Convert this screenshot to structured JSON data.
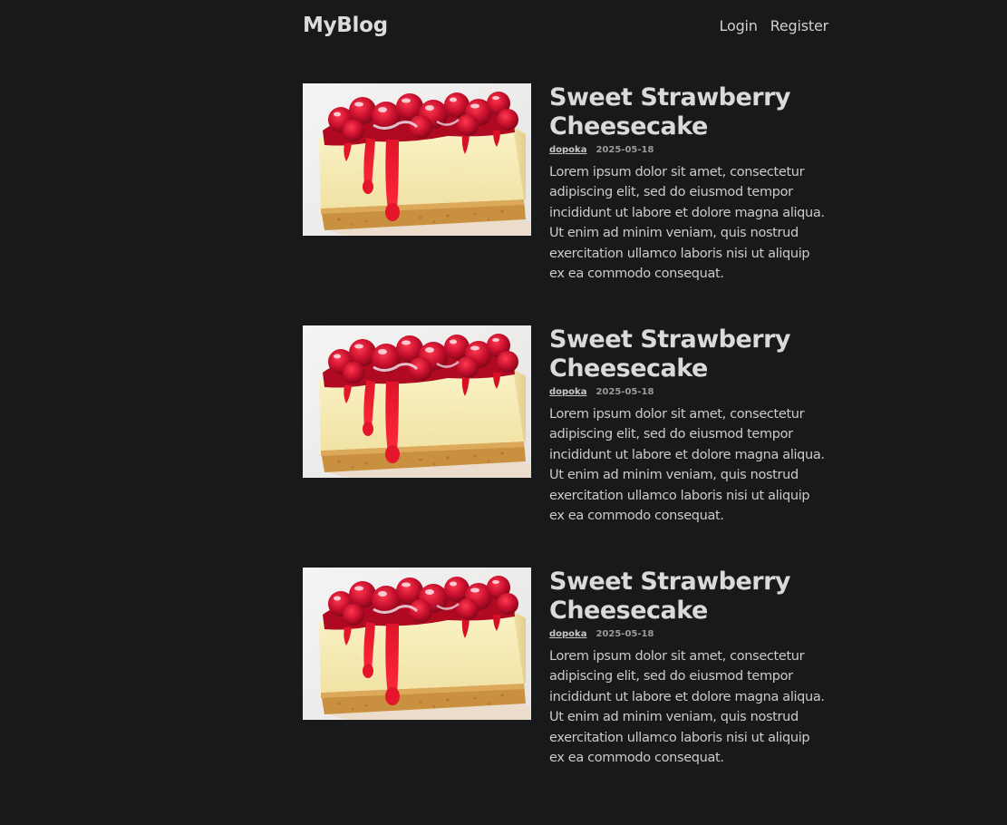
{
  "header": {
    "logo": "MyBlog",
    "nav": {
      "login": "Login",
      "register": "Register"
    }
  },
  "posts": [
    {
      "title": "Sweet Strawberry Cheesecake",
      "author": "dopoka",
      "date": "2025-05-18",
      "excerpt": "Lorem ipsum dolor sit amet, consectetur adipiscing elit, sed do eiusmod tempor incididunt ut labore et dolore magna aliqua. Ut enim ad minim veniam, quis nostrud exercitation ullamco laboris nisi ut aliquip ex ea commodo consequat."
    },
    {
      "title": "Sweet Strawberry Cheesecake",
      "author": "dopoka",
      "date": "2025-05-18",
      "excerpt": "Lorem ipsum dolor sit amet, consectetur adipiscing elit, sed do eiusmod tempor incididunt ut labore et dolore magna aliqua. Ut enim ad minim veniam, quis nostrud exercitation ullamco laboris nisi ut aliquip ex ea commodo consequat."
    },
    {
      "title": "Sweet Strawberry Cheesecake",
      "author": "dopoka",
      "date": "2025-05-18",
      "excerpt": "Lorem ipsum dolor sit amet, consectetur adipiscing elit, sed do eiusmod tempor incididunt ut labore et dolore magna aliqua. Ut enim ad minim veniam, quis nostrud exercitation ullamco laboris nisi ut aliquip ex ea commodo consequat."
    }
  ],
  "colors": {
    "background": "#18191b",
    "text": "#d0d0d0",
    "cheesecake_cream": "#f5eab5",
    "strawberry_red": "#c8102e"
  }
}
